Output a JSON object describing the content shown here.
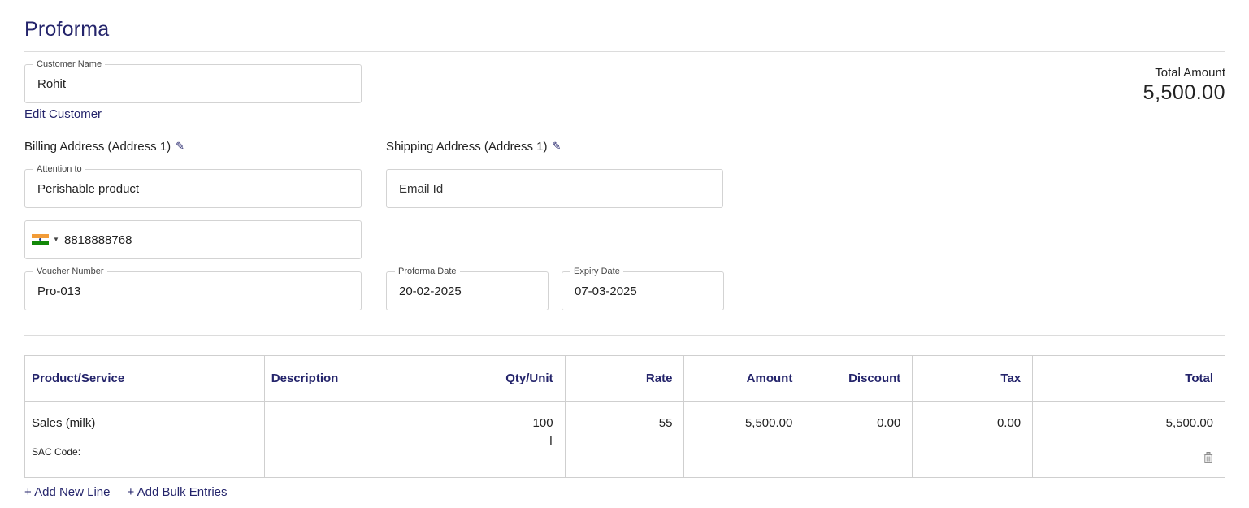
{
  "page": {
    "title": "Proforma"
  },
  "customer": {
    "label": "Customer Name",
    "value": "Rohit",
    "edit_link": "Edit Customer"
  },
  "total": {
    "label": "Total Amount",
    "value": "5,500.00"
  },
  "billing": {
    "heading": "Billing Address (Address 1)",
    "attention_label": "Attention to",
    "attention_value": "Perishable product",
    "phone": "8818888768"
  },
  "shipping": {
    "heading": "Shipping Address (Address 1)",
    "email_placeholder": "Email Id"
  },
  "voucher": {
    "label": "Voucher Number",
    "value": "Pro-013"
  },
  "proforma_date": {
    "label": "Proforma Date",
    "value": "20-02-2025"
  },
  "expiry_date": {
    "label": "Expiry Date",
    "value": "07-03-2025"
  },
  "table": {
    "headers": [
      "Product/Service",
      "Description",
      "Qty/Unit",
      "Rate",
      "Amount",
      "Discount",
      "Tax",
      "Total"
    ],
    "rows": [
      {
        "product": "Sales (milk)",
        "sac_label": "SAC Code:",
        "description": "",
        "qty": "100",
        "unit": "l",
        "rate": "55",
        "amount": "5,500.00",
        "discount": "0.00",
        "tax": "0.00",
        "total": "5,500.00"
      }
    ]
  },
  "actions": {
    "add_line": "+ Add New Line",
    "add_bulk": "+ Add Bulk Entries"
  },
  "colors": {
    "accent": "#24246b",
    "border": "#d3d3d3"
  }
}
